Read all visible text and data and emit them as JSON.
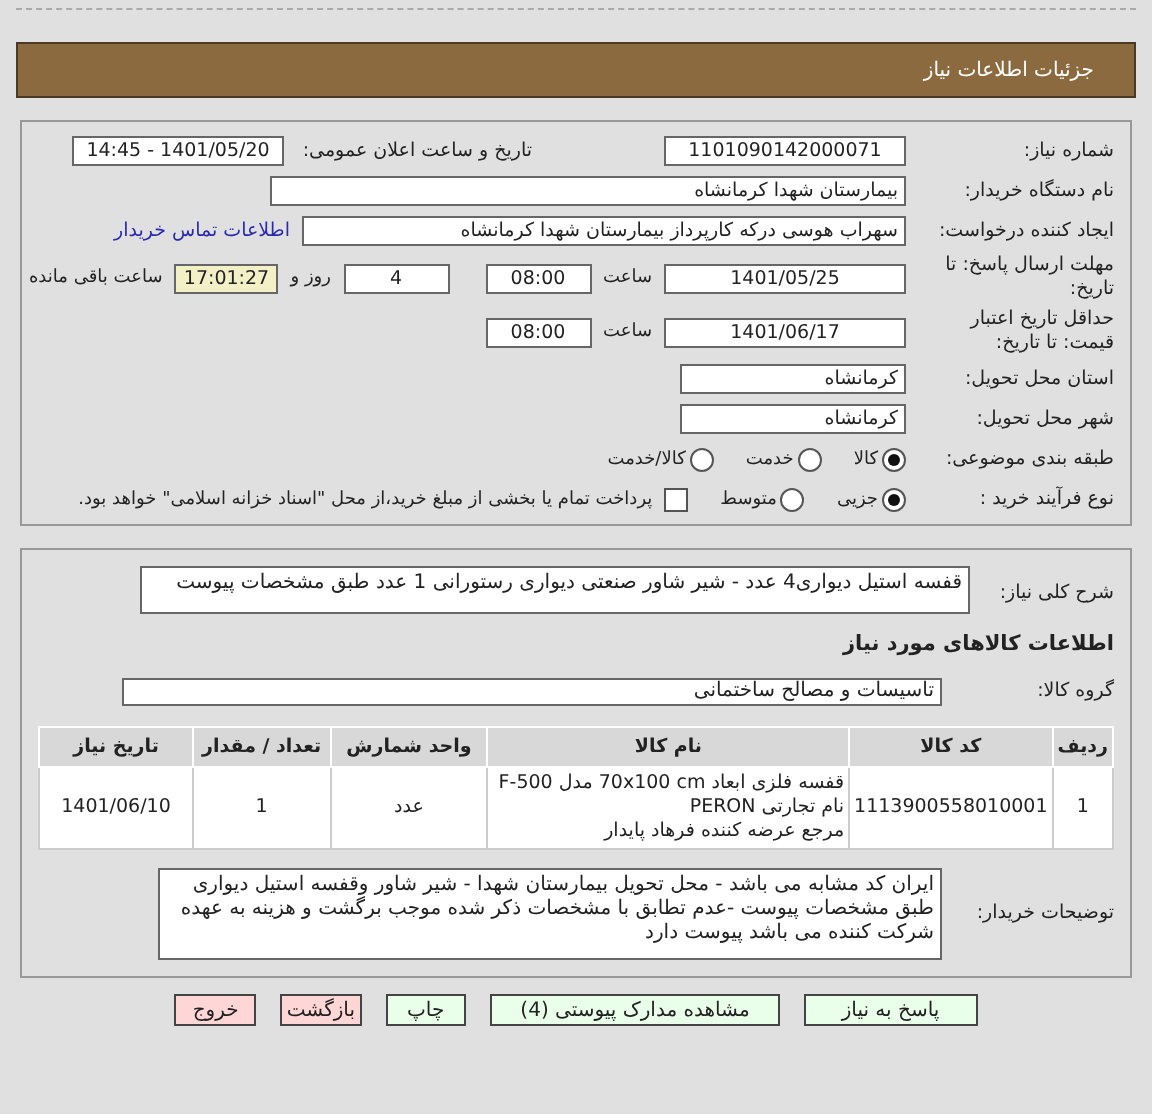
{
  "header": {
    "title": "جزئیات اطلاعات نیاز"
  },
  "need_number": {
    "label": "شماره نیاز:",
    "value": "1101090142000071",
    "announce_label": "تاریخ و ساعت اعلان عمومی:",
    "announce_value": "1401/05/20 - 14:45"
  },
  "buyer_org": {
    "label": "نام دستگاه خریدار:",
    "value": "بیمارستان شهدا کرمانشاه"
  },
  "requester": {
    "label": "ایجاد کننده درخواست:",
    "value": "سهراب هوسی درکه کارپرداز بیمارستان شهدا کرمانشاه",
    "link": "اطلاعات تماس خریدار"
  },
  "deadline": {
    "label": "مهلت ارسال پاسخ: تا تاریخ:",
    "date": "1401/05/25",
    "time_label": "ساعت",
    "time": "08:00",
    "days": "4",
    "days_label": "روز و",
    "remaining": "17:01:27",
    "remaining_label": "ساعت باقی مانده"
  },
  "validity": {
    "label": "حداقل تاریخ اعتبار قیمت: تا تاریخ:",
    "date": "1401/06/17",
    "time_label": "ساعت",
    "time": "08:00"
  },
  "province": {
    "label": "استان محل تحویل:",
    "value": "کرمانشاه"
  },
  "city": {
    "label": "شهر محل تحویل:",
    "value": "کرمانشاه"
  },
  "category": {
    "label": "طبقه بندی موضوعی:",
    "options": [
      {
        "label": "کالا",
        "selected": true
      },
      {
        "label": "خدمت",
        "selected": false
      },
      {
        "label": "کالا/خدمت",
        "selected": false
      }
    ]
  },
  "purchase_type": {
    "label": "نوع فرآیند خرید :",
    "options": [
      {
        "label": "جزیی",
        "selected": true
      },
      {
        "label": "متوسط",
        "selected": false
      }
    ],
    "treasury": {
      "label": "پرداخت تمام یا بخشی از مبلغ خرید،از محل \"اسناد خزانه اسلامی\" خواهد بود.",
      "checked": false
    }
  },
  "description": {
    "label": "شرح کلی نیاز:",
    "value": "قفسه استیل دیواری4 عدد - شیر شاور صنعتی دیواری رستورانی 1 عدد طبق مشخصات پیوست"
  },
  "goods_title": "اطلاعات کالاهای مورد نیاز",
  "goods_group": {
    "label": "گروه کالا:",
    "value": "تاسیسات و مصالح ساختمانی"
  },
  "table": {
    "columns": [
      "ردیف",
      "کد کالا",
      "نام کالا",
      "واحد شمارش",
      "تعداد / مقدار",
      "تاریخ نیاز"
    ],
    "rows": [
      {
        "cells": [
          "1",
          "1113900558010001",
          [
            "قفسه فلزی ابعاد 70x100 cm مدل F-500 نام تجارتی PERON",
            "مرجع عرضه کننده فرهاد پایدار"
          ],
          "عدد",
          "1",
          "1401/06/10"
        ]
      }
    ]
  },
  "buyer_notes": {
    "label": "توضیحات خریدار:",
    "value": "ایران کد مشابه می باشد - محل تحویل بیمارستان شهدا - شیر شاور وقفسه استیل دیواری طبق مشخصات پیوست -عدم تطابق با مشخصات ذکر شده موجب برگشت و هزینه به عهده شرکت کننده می باشد پیوست دارد"
  },
  "buttons": [
    {
      "label": "پاسخ به نیاز",
      "kind": "action"
    },
    {
      "label": "مشاهده مدارک پیوستی (4)",
      "kind": "action"
    },
    {
      "label": "چاپ",
      "kind": "action"
    },
    {
      "label": "بازگشت",
      "kind": "exit"
    },
    {
      "label": "خروج",
      "kind": "exit"
    }
  ]
}
